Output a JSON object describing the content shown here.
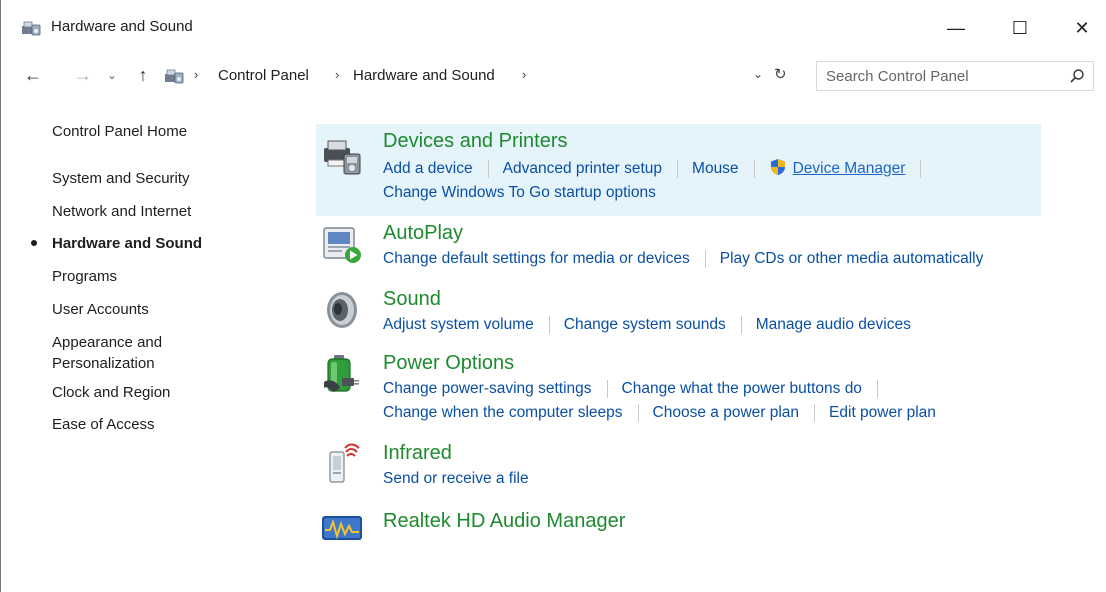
{
  "window": {
    "title": "Hardware and Sound",
    "minimize_glyph": "—",
    "maximize_glyph": "☐",
    "close_glyph": "✕"
  },
  "nav": {
    "back_glyph": "←",
    "forward_glyph": "→",
    "recent_glyph": "⌄",
    "up_glyph": "↑",
    "breadcrumb": [
      "Control Panel",
      "Hardware and Sound"
    ],
    "separator": "›",
    "dropdown_glyph": "⌄",
    "refresh_glyph": "↻",
    "search_placeholder": "Search Control Panel"
  },
  "sidebar": {
    "items": [
      {
        "label": "Control Panel Home"
      },
      {
        "label": "System and Security"
      },
      {
        "label": "Network and Internet"
      },
      {
        "label": "Hardware and Sound",
        "current": true
      },
      {
        "label": "Programs"
      },
      {
        "label": "User Accounts"
      },
      {
        "label": "Appearance and"
      },
      {
        "label": "Personalization"
      },
      {
        "label": "Clock and Region"
      },
      {
        "label": "Ease of Access"
      }
    ]
  },
  "categories": {
    "devices": {
      "title": "Devices and Printers",
      "icon": "printer-icon",
      "links": [
        "Add a device",
        "Advanced printer setup",
        "Mouse",
        "Device Manager",
        "Change Windows To Go startup options"
      ]
    },
    "autoplay": {
      "title": "AutoPlay",
      "icon": "autoplay-icon",
      "links": [
        "Change default settings for media or devices",
        "Play CDs or other media automatically"
      ]
    },
    "sound": {
      "title": "Sound",
      "icon": "speaker-icon",
      "links": [
        "Adjust system volume",
        "Change system sounds",
        "Manage audio devices"
      ]
    },
    "power": {
      "title": "Power Options",
      "icon": "battery-icon",
      "links": [
        "Change power-saving settings",
        "Change what the power buttons do",
        "Change when the computer sleeps",
        "Choose a power plan",
        "Edit power plan"
      ]
    },
    "infrared": {
      "title": "Infrared",
      "icon": "infrared-icon",
      "links": [
        "Send or receive a file"
      ]
    },
    "realtek": {
      "title": "Realtek HD Audio Manager",
      "icon": "audio-wave-icon"
    }
  },
  "colors": {
    "title_green": "#1e8a2e",
    "link_blue": "#0a4fa3",
    "highlight_bg": "#e5f3fb"
  }
}
